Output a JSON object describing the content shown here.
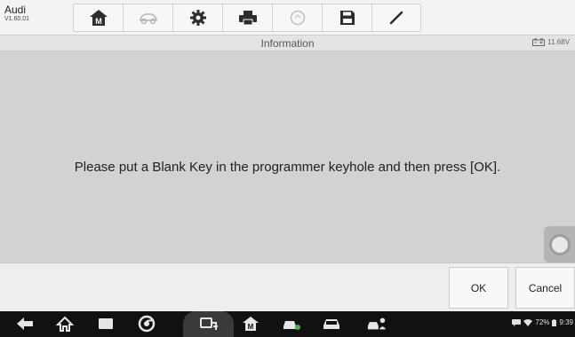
{
  "app": {
    "name": "Audi",
    "version": "V1.60.01"
  },
  "toolbar": {
    "icons": [
      "home-icon",
      "vehicle-icon",
      "settings-icon",
      "print-icon",
      "help-icon",
      "save-icon",
      "edit-icon"
    ]
  },
  "header": {
    "title": "Information",
    "voltage": "11.68V"
  },
  "dialog": {
    "message": "Please put a Blank Key in the programmer keyhole and then press [OK]."
  },
  "actions": {
    "ok_label": "OK",
    "cancel_label": "Cancel"
  },
  "system_nav": {
    "icons": [
      "back-icon",
      "home-icon",
      "recents-icon",
      "chrome-icon",
      "vci-icon",
      "diag-home-icon",
      "car-service-icon",
      "car-icon",
      "remote-icon"
    ]
  },
  "status": {
    "battery": "72%",
    "time": "9:39"
  },
  "colors": {
    "background": "#d2d2d2",
    "toolbar": "#f3f3f3",
    "navbar": "#111111"
  }
}
